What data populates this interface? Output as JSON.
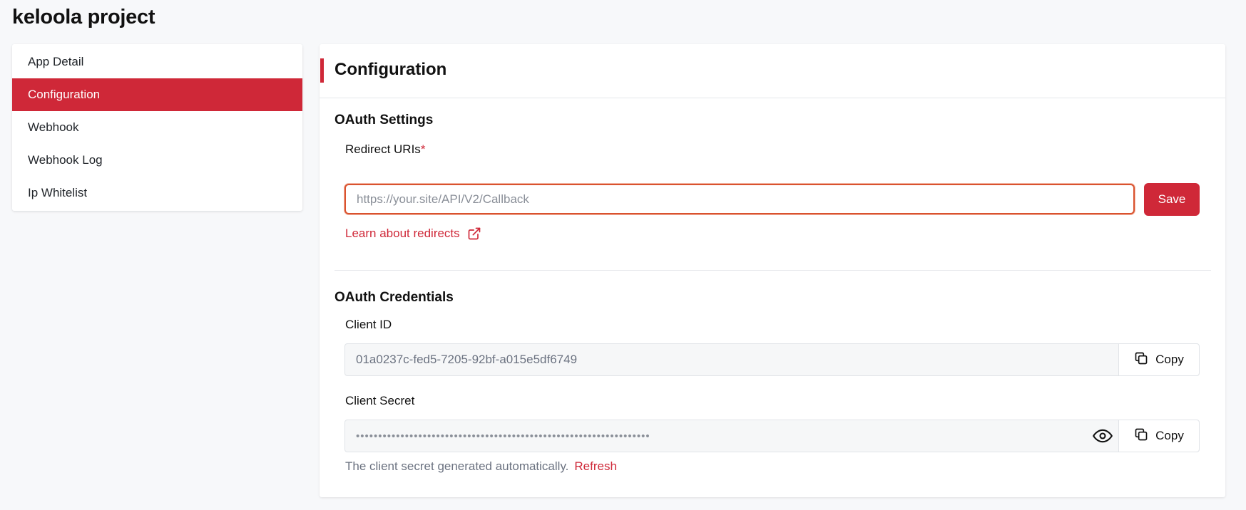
{
  "page": {
    "title": "keloola project"
  },
  "sidebar": {
    "items": [
      {
        "label": "App Detail",
        "active": false
      },
      {
        "label": "Configuration",
        "active": true
      },
      {
        "label": "Webhook",
        "active": false
      },
      {
        "label": "Webhook Log",
        "active": false
      },
      {
        "label": "Ip Whitelist",
        "active": false
      }
    ]
  },
  "main": {
    "title": "Configuration",
    "oauth_settings": {
      "title": "OAuth Settings",
      "redirect_label": "Redirect URIs",
      "required_mark": "*",
      "redirect_value": "",
      "redirect_placeholder": "https://your.site/API/V2/Callback",
      "save_label": "Save",
      "learn_link": "Learn about redirects"
    },
    "oauth_credentials": {
      "title": "OAuth Credentials",
      "client_id_label": "Client ID",
      "client_id_value": "01a0237c-fed5-7205-92bf-a015e5df6749",
      "client_secret_label": "Client Secret",
      "client_secret_masked": "••••••••••••••••••••••••••••••••••••••••••••••••••••••••••••••••••",
      "copy_label": "Copy",
      "helper_text": "The client secret generated automatically.",
      "refresh_label": "Refresh"
    }
  },
  "colors": {
    "accent": "#cf2838",
    "background": "#f7f8fa"
  },
  "icons": [
    "external-link-icon",
    "copy-icon",
    "eye-icon"
  ]
}
